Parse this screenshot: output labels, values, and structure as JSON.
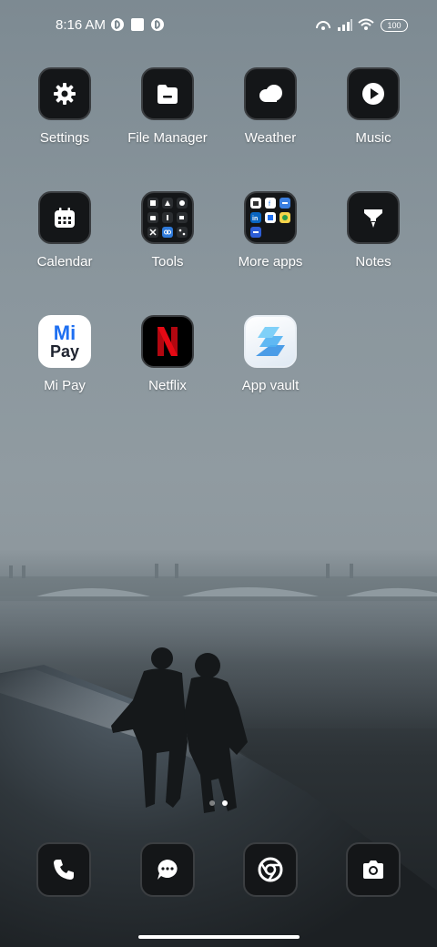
{
  "status_bar": {
    "time": "8:16 AM",
    "battery": "100"
  },
  "apps": [
    {
      "label": "Settings",
      "icon": "gear-icon"
    },
    {
      "label": "File Manager",
      "icon": "folder-icon"
    },
    {
      "label": "Weather",
      "icon": "cloud-icon"
    },
    {
      "label": "Music",
      "icon": "play-icon"
    },
    {
      "label": "Calendar",
      "icon": "calendar-icon"
    },
    {
      "label": "Tools",
      "icon": "folder-grid-icon"
    },
    {
      "label": "More apps",
      "icon": "folder-grid-icon"
    },
    {
      "label": "Notes",
      "icon": "notes-icon"
    },
    {
      "label": "Mi Pay",
      "icon": "mi-pay-logo"
    },
    {
      "label": "Netflix",
      "icon": "netflix-logo"
    },
    {
      "label": "App vault",
      "icon": "app-vault-icon"
    }
  ],
  "mi_pay_logo_text": {
    "top": "Mi",
    "bottom": "Pay"
  },
  "dock": [
    {
      "name": "phone",
      "icon": "phone-icon"
    },
    {
      "name": "messages",
      "icon": "chat-icon"
    },
    {
      "name": "chrome",
      "icon": "chrome-icon"
    },
    {
      "name": "camera",
      "icon": "camera-icon"
    }
  ],
  "page_indicator": {
    "pages": 2,
    "current": 2
  },
  "colors": {
    "tile_bg": "#141618",
    "netflix_red": "#e50914",
    "mi_pay_blue": "#1e6ff1"
  }
}
